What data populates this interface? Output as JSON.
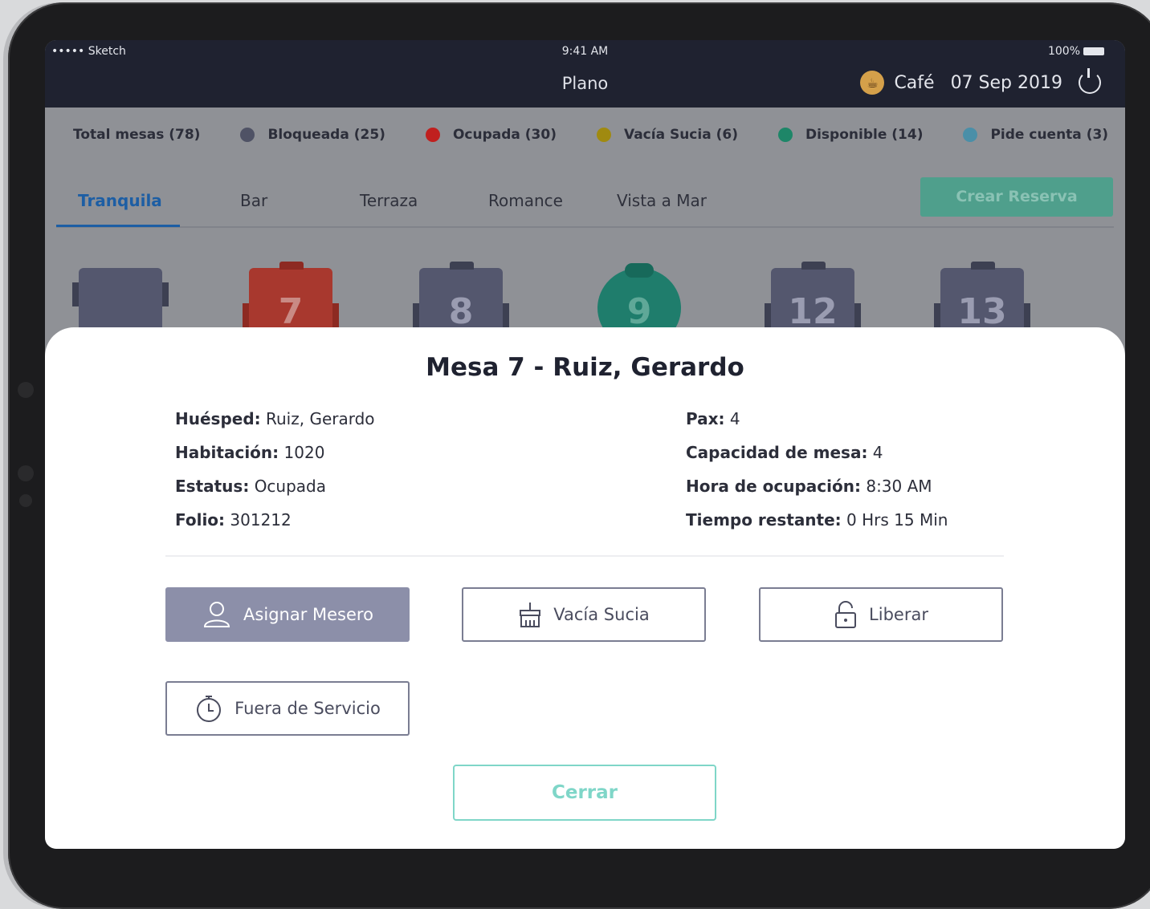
{
  "status": {
    "carrier": "••••• Sketch",
    "time": "9:41 AM",
    "battery": "100%"
  },
  "nav": {
    "title": "Plano",
    "venue": "Café",
    "date": "07 Sep 2019"
  },
  "legend": [
    {
      "label": "Total mesas (78)",
      "color": ""
    },
    {
      "label": "Bloqueada (25)",
      "color": "#4f5265"
    },
    {
      "label": "Ocupada (30)",
      "color": "#c0201f"
    },
    {
      "label": "Vacía Sucia (6)",
      "color": "#a08a10"
    },
    {
      "label": "Disponible (14)",
      "color": "#1e8668"
    },
    {
      "label": "Pide cuenta (3)",
      "color": "#4a8fa8"
    }
  ],
  "tabs": [
    "Tranquila",
    "Bar",
    "Terraza",
    "Romance",
    "Vista a Mar"
  ],
  "crear_label": "Crear Reserva",
  "tables": [
    {
      "number": "",
      "color": "#54576e"
    },
    {
      "number": "7",
      "color": "#a8382e"
    },
    {
      "number": "8",
      "color": "#54576e"
    },
    {
      "number": "9",
      "color": "#1f7d6c"
    },
    {
      "number": "12",
      "color": "#54576e"
    },
    {
      "number": "13",
      "color": "#54576e"
    }
  ],
  "modal": {
    "title": "Mesa 7 - Ruiz, Gerardo",
    "left": [
      {
        "label": "Huésped:",
        "value": "Ruiz, Gerardo"
      },
      {
        "label": "Habitación:",
        "value": "1020"
      },
      {
        "label": "Estatus:",
        "value": "Ocupada"
      },
      {
        "label": "Folio:",
        "value": "301212"
      }
    ],
    "right": [
      {
        "label": "Pax:",
        "value": "4"
      },
      {
        "label": "Capacidad de mesa:",
        "value": "4"
      },
      {
        "label": "Hora de ocupación:",
        "value": "8:30 AM"
      },
      {
        "label": "Tiempo restante:",
        "value": "0 Hrs 15 Min"
      }
    ],
    "buttons": {
      "asignar": "Asignar Mesero",
      "vacia": "Vacía Sucia",
      "liberar": "Liberar",
      "fuera": "Fuera de Servicio"
    },
    "cerrar": "Cerrar"
  }
}
